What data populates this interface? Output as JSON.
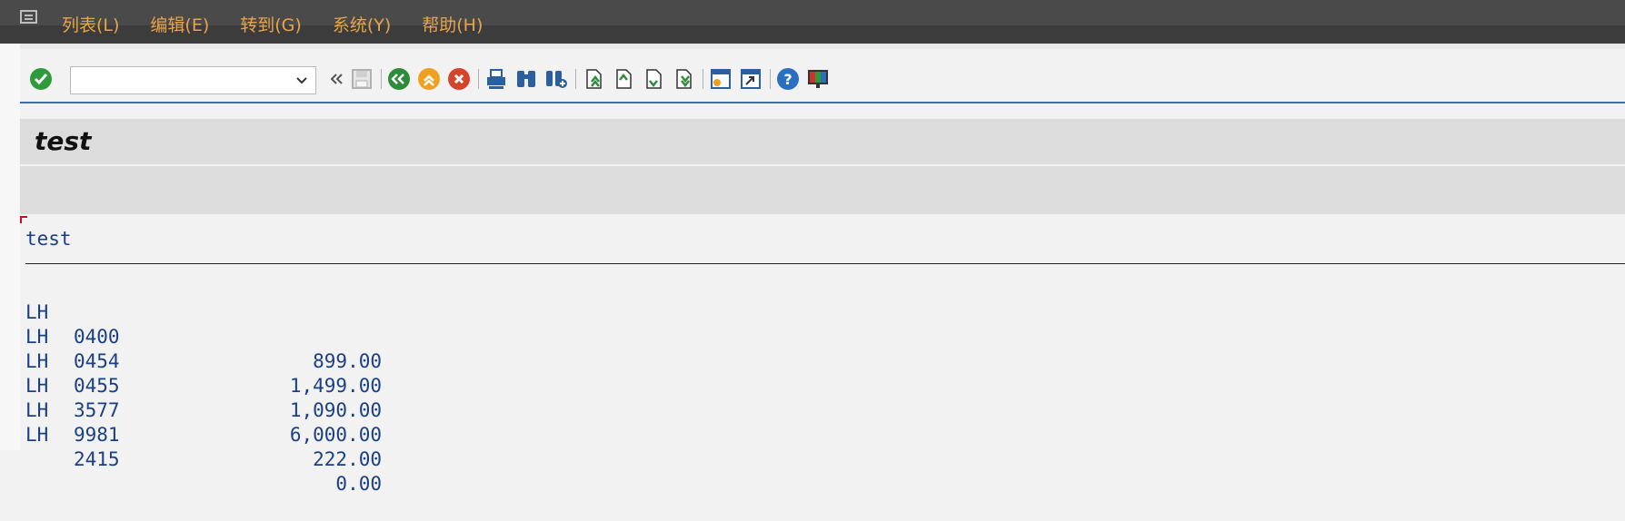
{
  "menubar": {
    "items": [
      {
        "label": "列表(L)"
      },
      {
        "label": "编辑(E)"
      },
      {
        "label": "转到(G)"
      },
      {
        "label": "系统(Y)"
      },
      {
        "label": "帮助(H)"
      }
    ]
  },
  "toolbar": {
    "command_field": {
      "value": "",
      "placeholder": ""
    },
    "icons": [
      "enter-icon",
      "back-double-icon",
      "save-icon",
      "back-icon",
      "exit-icon",
      "cancel-icon",
      "print-icon",
      "find-icon",
      "find-next-icon",
      "first-page-icon",
      "previous-page-icon",
      "next-page-icon",
      "last-page-icon",
      "create-session-icon",
      "shortcut-icon",
      "help-icon",
      "layout-icon"
    ]
  },
  "title": "test",
  "list": {
    "header": "test",
    "rows": [
      {
        "carrier": "LH",
        "code": "0400",
        "amount": "899.00"
      },
      {
        "carrier": "LH",
        "code": "0454",
        "amount": "1,499.00"
      },
      {
        "carrier": "LH",
        "code": "0455",
        "amount": "1,090.00"
      },
      {
        "carrier": "LH",
        "code": "3577",
        "amount": "6,000.00"
      },
      {
        "carrier": "LH",
        "code": "9981",
        "amount": "222.00"
      },
      {
        "carrier": "LH",
        "code": "2415",
        "amount": "0.00"
      }
    ]
  },
  "colors": {
    "menu_text": "#e8a44a",
    "list_text": "#1a3f82",
    "menubar_bg": "#3c3c3c"
  }
}
